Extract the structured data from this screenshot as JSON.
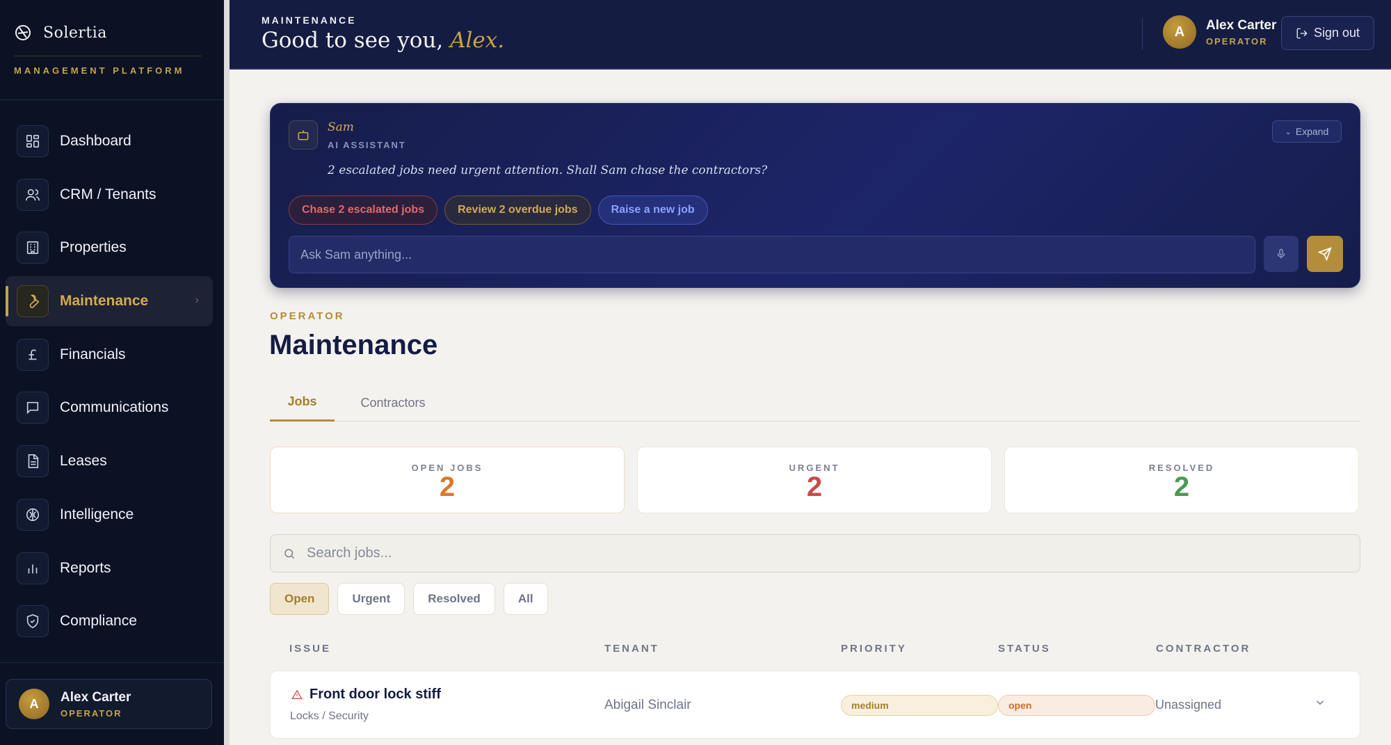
{
  "sidebar": {
    "brand_name": "Solertia",
    "brand_subtitle": "MANAGEMENT PLATFORM",
    "items": [
      {
        "label": "Dashboard",
        "icon": "dashboard-icon"
      },
      {
        "label": "CRM / Tenants",
        "icon": "users-icon"
      },
      {
        "label": "Properties",
        "icon": "building-icon"
      },
      {
        "label": "Maintenance",
        "icon": "wrench-icon",
        "active": true
      },
      {
        "label": "Financials",
        "icon": "pound-icon"
      },
      {
        "label": "Communications",
        "icon": "message-icon"
      },
      {
        "label": "Leases",
        "icon": "document-icon"
      },
      {
        "label": "Intelligence",
        "icon": "brain-icon"
      },
      {
        "label": "Reports",
        "icon": "bar-chart-icon"
      },
      {
        "label": "Compliance",
        "icon": "shield-icon"
      }
    ],
    "user": {
      "initial": "A",
      "name": "Alex Carter",
      "role": "OPERATOR"
    }
  },
  "header": {
    "eyebrow": "MAINTENANCE",
    "greeting": "Good to see you,",
    "greeting_name": "Alex.",
    "user": {
      "initial": "A",
      "name": "Alex Carter",
      "role": "OPERATOR"
    },
    "signout_label": "Sign out"
  },
  "assistant": {
    "name": "Sam",
    "role": "AI ASSISTANT",
    "expand_label": "Expand",
    "message": "2 escalated jobs need urgent attention. Shall Sam chase the contractors?",
    "chips": [
      "Chase 2 escalated jobs",
      "Review 2 overdue jobs",
      "Raise a new job"
    ],
    "input_placeholder": "Ask Sam anything..."
  },
  "page": {
    "eyebrow": "OPERATOR",
    "title": "Maintenance"
  },
  "tabs": [
    "Jobs",
    "Contractors"
  ],
  "stats": [
    {
      "label": "OPEN JOBS",
      "value": "2",
      "color": "#d97a2b"
    },
    {
      "label": "URGENT",
      "value": "2",
      "color": "#c94a4a"
    },
    {
      "label": "RESOLVED",
      "value": "2",
      "color": "#4a9a55"
    }
  ],
  "search": {
    "placeholder": "Search jobs..."
  },
  "filters": [
    "Open",
    "Urgent",
    "Resolved",
    "All"
  ],
  "table": {
    "headers": [
      "ISSUE",
      "TENANT",
      "PRIORITY",
      "STATUS",
      "CONTRACTOR"
    ],
    "rows": [
      {
        "issue": "Front door lock stiff",
        "category": "Locks / Security",
        "tenant": "Abigail Sinclair",
        "priority": "medium",
        "status": "open",
        "contractor": "Unassigned"
      }
    ]
  },
  "colors": {
    "accent": "#c8a24a",
    "navy": "#141c42",
    "sidebar_bg": "#0b1224"
  }
}
